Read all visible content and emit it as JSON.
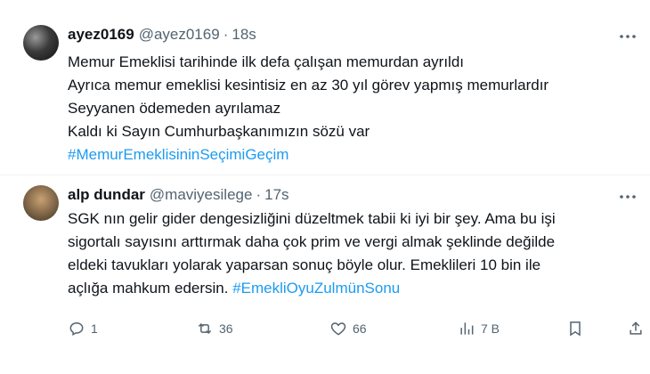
{
  "tweets": [
    {
      "display_name": "ayez0169",
      "handle": "@ayez0169",
      "separator": "·",
      "time": "18s",
      "lines": [
        "Memur Emeklisi tarihinde ilk defa çalışan memurdan ayrıldı",
        "Ayrıca memur emeklisi kesintisiz en az 30 yıl görev yapmış memurlardır",
        "Seyyanen ödemeden ayrılamaz",
        "Kaldı ki Sayın Cumhurbaşkanımızın sözü var"
      ],
      "hashtag": "#MemurEmeklisininSeçimiGeçim"
    },
    {
      "display_name": "alp dundar",
      "handle": "@maviyesilege",
      "separator": "·",
      "time": "17s",
      "lines": [
        "SGK nın gelir gider dengesizliğini düzeltmek tabii ki iyi bir şey. Ama bu işi",
        "sigortalı sayısını arttırmak daha çok prim ve vergi almak şeklinde değilde",
        "eldeki tavukları yolarak yaparsan sonuç böyle olur. Emeklileri 10 bin ile"
      ],
      "last_line_text": "açlığa mahkum edersin. ",
      "hashtag": "#EmekliOyuZulmünSonu",
      "actions": {
        "replies": "1",
        "retweets": "36",
        "likes": "66",
        "views": "7 B"
      }
    }
  ],
  "colors": {
    "link": "#1d9bf0",
    "text": "#0f1419",
    "muted": "#536471"
  },
  "icons": [
    "more-icon",
    "reply-icon",
    "retweet-icon",
    "like-icon",
    "views-icon",
    "share-icon"
  ]
}
